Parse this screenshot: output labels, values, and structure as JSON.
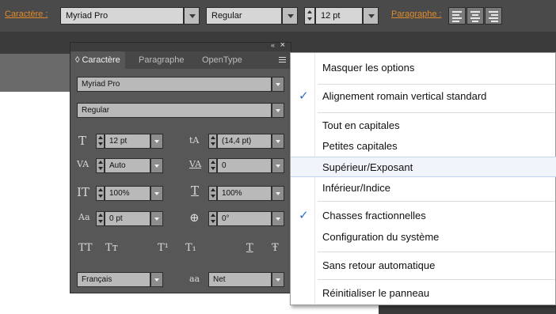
{
  "control_bar": {
    "caractere_link": "Caractère :",
    "font_family": "Myriad Pro",
    "font_style": "Regular",
    "font_size": "12 pt",
    "paragraphe_link": "Paragraphe :"
  },
  "panel": {
    "tabs": [
      "◊ Caractère",
      "Paragraphe",
      "OpenType"
    ],
    "collapse_glyph": "«",
    "close_glyph": "×",
    "font_family": "Myriad Pro",
    "font_style": "Regular",
    "size": "12 pt",
    "leading": "(14,4 pt)",
    "kerning": "Auto",
    "tracking": "0",
    "vertical_scale": "100%",
    "horizontal_scale": "100%",
    "baseline_shift": "0 pt",
    "rotation": "0°",
    "typo_buttons": [
      "TT",
      "Tт",
      "T¹",
      "T₁",
      "T",
      "Ŧ"
    ],
    "language": "Français",
    "antialias_icon_text": "aa",
    "antialias": "Net"
  },
  "menu": {
    "check_glyph": "✓",
    "items": [
      {
        "label": "Masquer les options",
        "checked": false
      },
      {
        "label": "Alignement romain vertical standard",
        "checked": true
      },
      {
        "label": "Tout en capitales",
        "checked": false
      },
      {
        "label": "Petites capitales",
        "checked": false
      },
      {
        "label": "Supérieur/Exposant",
        "checked": false,
        "highlighted": true
      },
      {
        "label": "Inférieur/Indice",
        "checked": false
      },
      {
        "label": "Chasses fractionnelles",
        "checked": true
      },
      {
        "label": "Configuration du système",
        "checked": false
      },
      {
        "label": "Sans retour automatique",
        "checked": false
      },
      {
        "label": "Réinitialiser le panneau",
        "checked": false
      }
    ]
  }
}
